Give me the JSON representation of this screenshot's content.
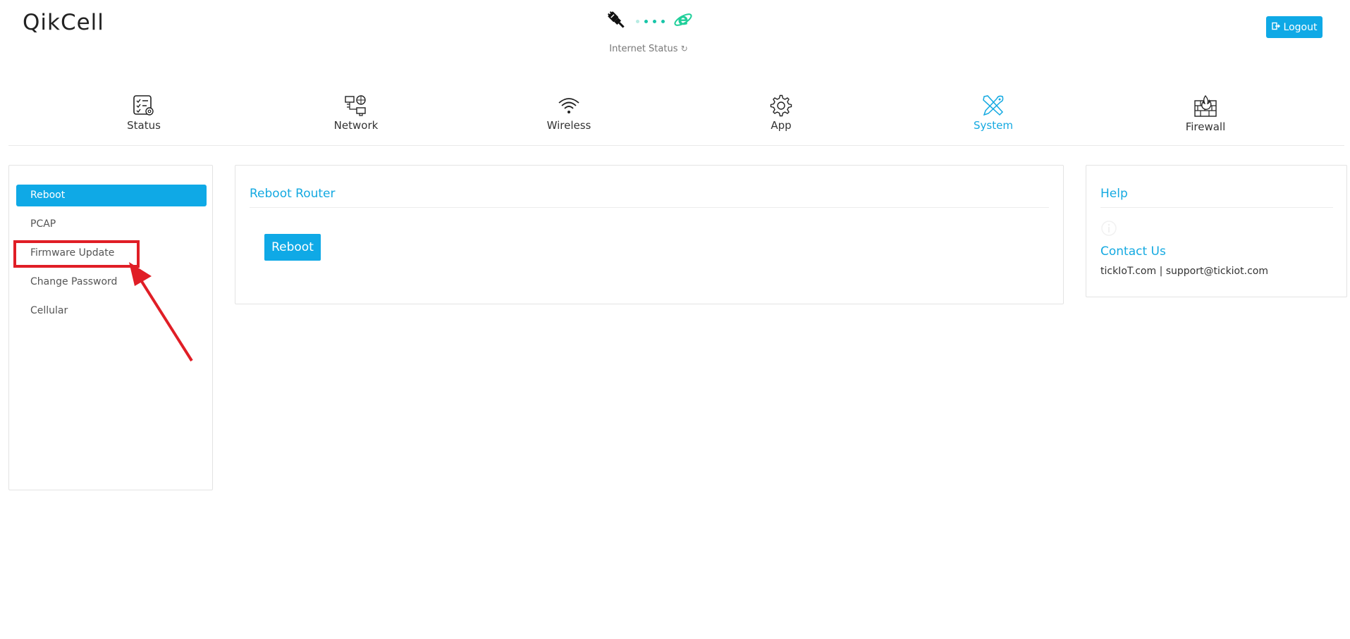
{
  "header": {
    "brand": "QikCell",
    "internet_status_label": "Internet Status",
    "logout_label": "Logout"
  },
  "nav": [
    {
      "label": "Status",
      "icon": "status-checklist-icon"
    },
    {
      "label": "Network",
      "icon": "network-icon"
    },
    {
      "label": "Wireless",
      "icon": "wifi-icon"
    },
    {
      "label": "App",
      "icon": "gear-icon"
    },
    {
      "label": "System",
      "icon": "tools-icon",
      "active": true
    },
    {
      "label": "Firewall",
      "icon": "firewall-icon"
    }
  ],
  "sidebar": {
    "items": [
      {
        "label": "Reboot",
        "active": true
      },
      {
        "label": "PCAP"
      },
      {
        "label": "Firmware Update"
      },
      {
        "label": "Change Password"
      },
      {
        "label": "Cellular"
      }
    ]
  },
  "main": {
    "title": "Reboot Router",
    "reboot_button": "Reboot"
  },
  "help": {
    "title": "Help",
    "contact_title": "Contact Us",
    "contact_text": "tickIoT.com | support@tickiot.com"
  },
  "colors": {
    "accent": "#0fa9e6",
    "highlight": "#e01e26"
  }
}
